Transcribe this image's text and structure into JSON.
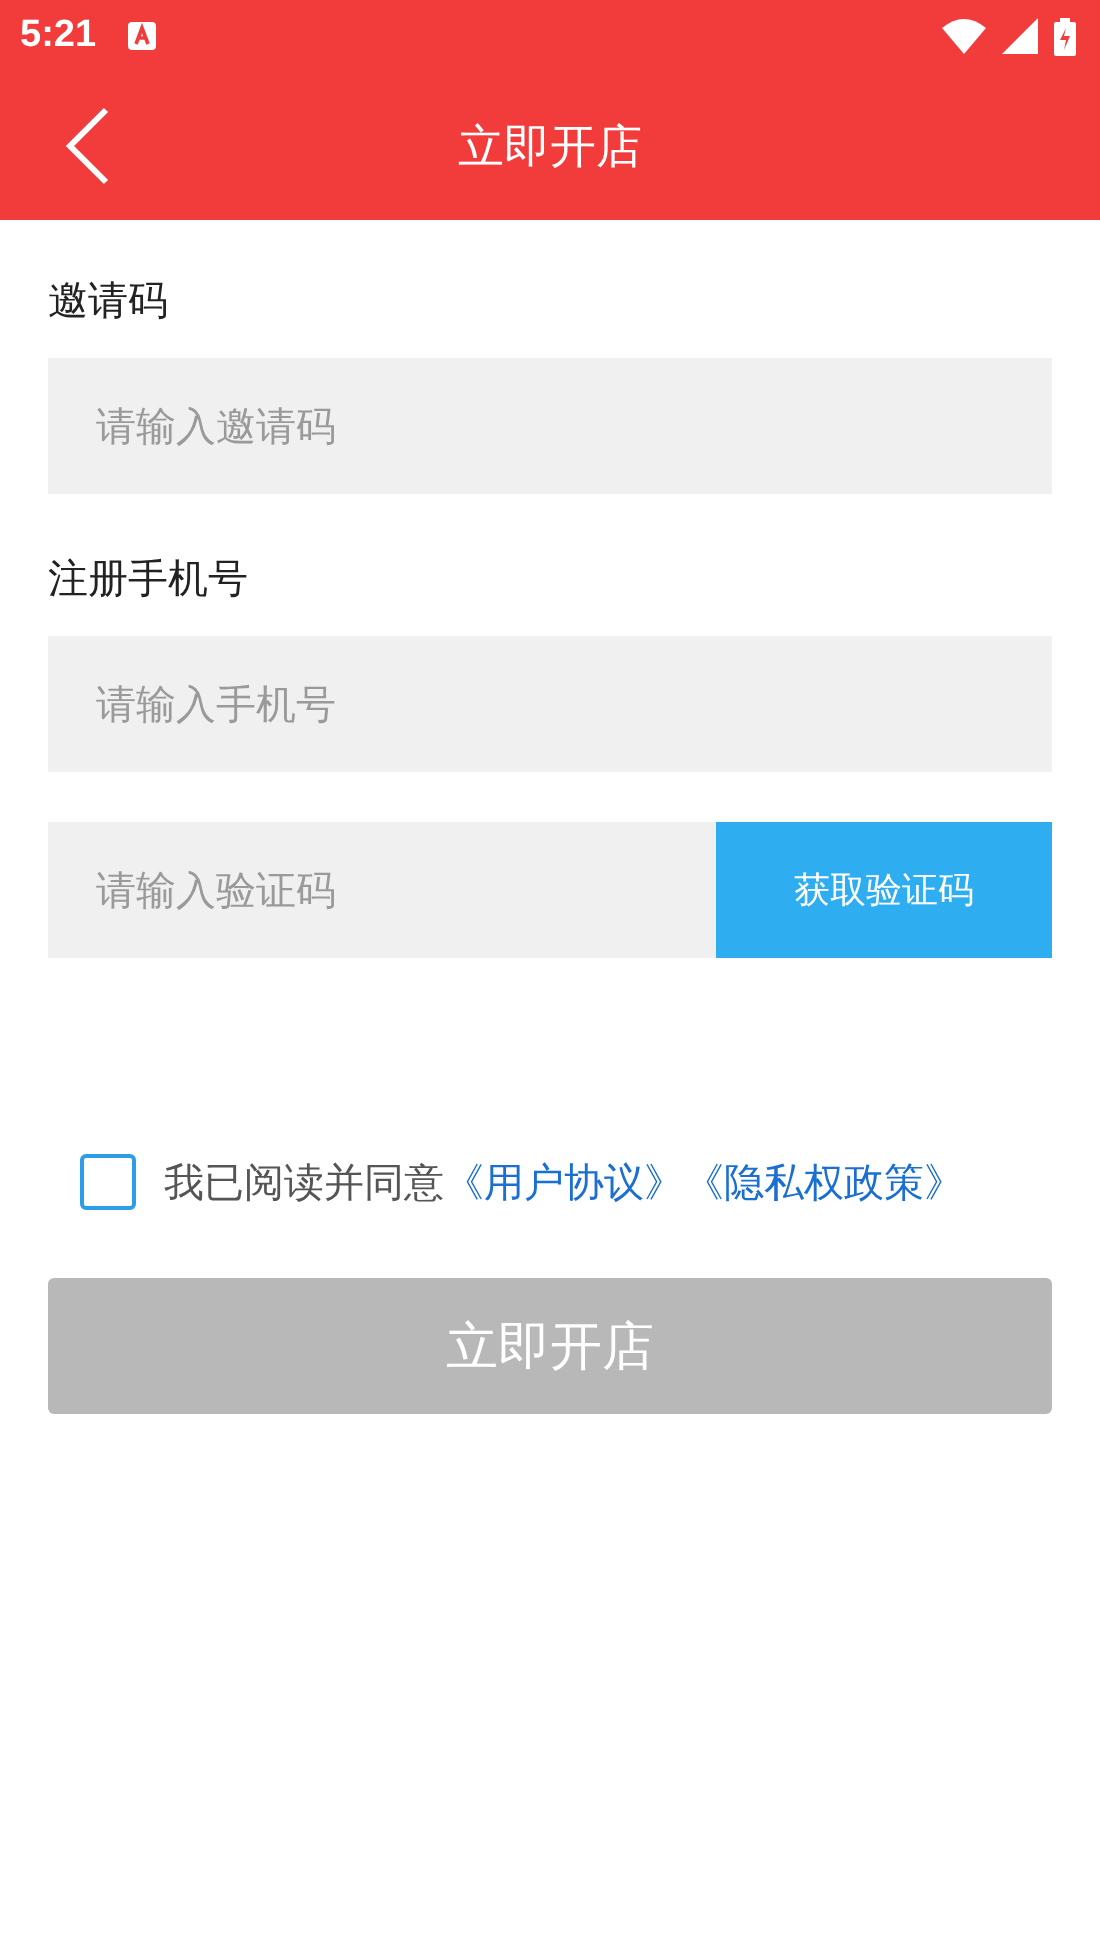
{
  "status_bar": {
    "time": "5:21"
  },
  "header": {
    "title": "立即开店"
  },
  "fields": [
    {
      "label": "邀请码",
      "placeholder": "请输入邀请码"
    },
    {
      "label": "注册手机号",
      "placeholder": "请输入手机号"
    }
  ],
  "code": {
    "placeholder": "请输入验证码",
    "button": "获取验证码"
  },
  "agreement": {
    "checked": false,
    "text": "我已阅读并同意",
    "links": [
      "《用户协议》",
      "《隐私权政策》"
    ]
  },
  "submit": {
    "label": "立即开店",
    "disabled": true
  }
}
